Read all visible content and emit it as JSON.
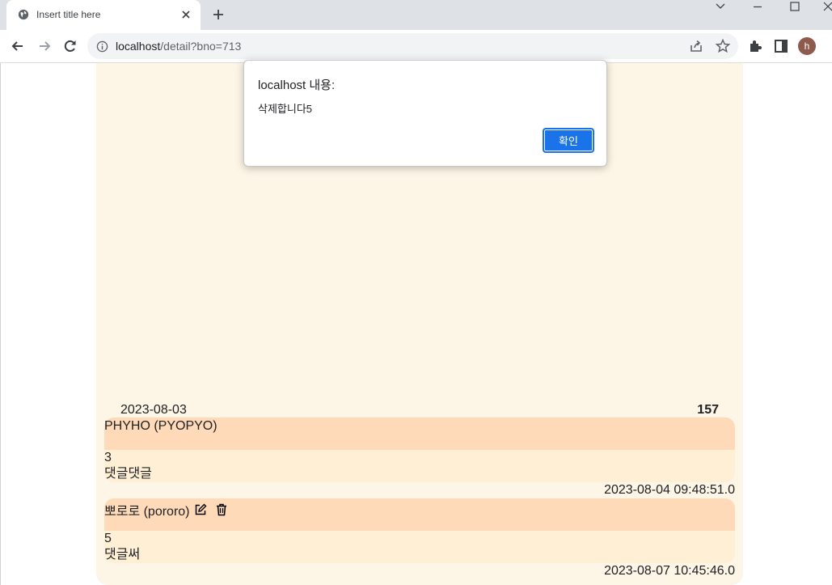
{
  "browser": {
    "tab_title": "Insert title here",
    "url_host": "localhost",
    "url_path": "/detail?bno=713",
    "profile_initial": "h"
  },
  "post": {
    "date": "2023-08-03",
    "count": "157"
  },
  "comments": [
    {
      "author": "PHYHO (PYOPYO)",
      "number": "3",
      "text": "댓글댓글",
      "timestamp": "2023-08-04 09:48:51.0",
      "editable": false
    },
    {
      "author": "뽀로로 (pororo)",
      "number": "5",
      "text": "댓글써",
      "timestamp": "2023-08-07 10:45:46.0",
      "editable": true
    }
  ],
  "dialog": {
    "title": "localhost 내용:",
    "message": "삭제합니다5",
    "ok_label": "확인"
  },
  "colors": {
    "board_bg": "#fdf5e6",
    "comment_head": "#ffdab9",
    "comment_body": "#ffefd5",
    "button_blue": "#1a73e8"
  }
}
